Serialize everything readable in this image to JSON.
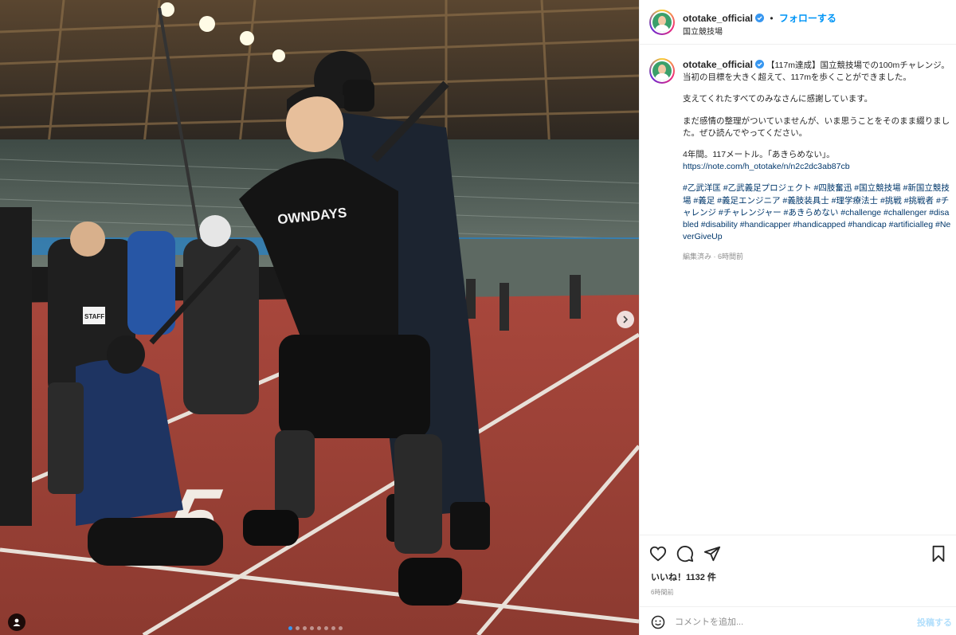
{
  "post": {
    "username": "ototake_official",
    "follow_label": "フォローする",
    "separator": "•",
    "location": "国立競技場"
  },
  "caption": {
    "username": "ototake_official",
    "paragraph1": "【117m達成】国立競技場での100mチャレンジ。当初の目標を大きく超えて、117mを歩くことができました。",
    "paragraph2": "支えてくれたすべてのみなさんに感謝しています。",
    "paragraph3": "まだ感情の整理がついていませんが、いま思うことをそのまま綴りました。ぜひ読んでやってください。",
    "paragraph4_line1": "4年間。117メートル。「あきらめない」。",
    "paragraph4_url": "https://note.com/h_ototake/n/n2c2dc3ab87cb",
    "hashtags": "#乙武洋匡 #乙武義足プロジェクト #四肢奮迅 #国立競技場 #新国立競技場 #義足 #義足エンジニア #義肢装具士 #理学療法士 #挑戦 #挑戦者 #チャレンジ #チャレンジャー #あきらめない #challenge #challenger #disabled #disability #handicapper #handicapped #handicap #artificialleg #NeverGiveUp",
    "meta": "編集済み · 6時間前"
  },
  "engagement": {
    "likes": "いいね！1132 件",
    "time": "6時間前"
  },
  "comment": {
    "placeholder": "コメントを追加...",
    "post_label": "投稿する"
  },
  "photo": {
    "shirt_text": "OWNDAYS",
    "staff_badge": "STAFF",
    "lane_number": "5"
  },
  "colors": {
    "accent": "#0095f6",
    "verified": "#3897f0",
    "track": "#b5483e",
    "text": "#262626",
    "muted": "#8e8e8e"
  },
  "carousel": {
    "count": 8,
    "active_index": 0
  }
}
